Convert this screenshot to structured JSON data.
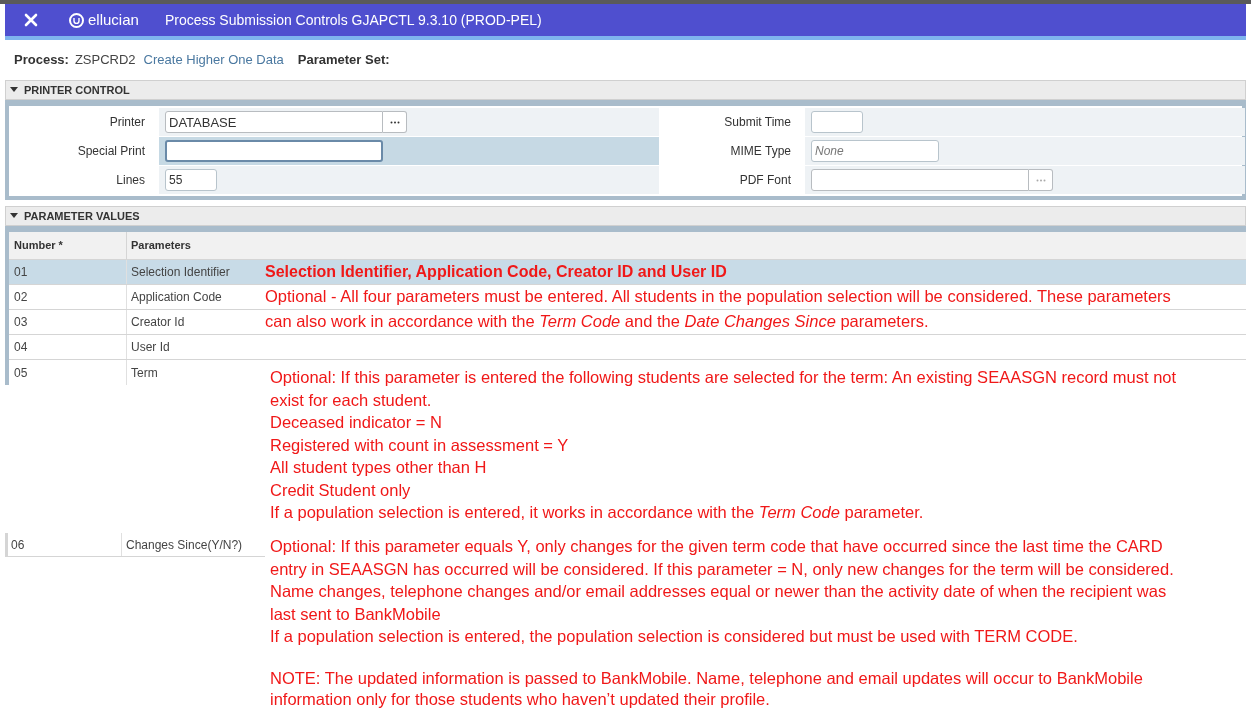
{
  "header": {
    "logo": "ellucian",
    "title": "Process Submission Controls GJAPCTL 9.3.10 (PROD-PEL)"
  },
  "process": {
    "label": "Process:",
    "code": "ZSPCRD2",
    "name": "Create Higher One Data",
    "parameter_set_label": "Parameter Set:"
  },
  "printer_control": {
    "title": "PRINTER CONTROL",
    "expanded": true,
    "left_fields": [
      {
        "label": "Printer",
        "value": "DATABASE",
        "kind": "lookup",
        "selected": false
      },
      {
        "label": "Special Print",
        "kind": "text",
        "selected": true
      },
      {
        "label": "Lines",
        "value": "55",
        "kind": "short",
        "selected": false
      }
    ],
    "right_fields": [
      {
        "label": "Submit Time",
        "kind": "short"
      },
      {
        "label": "MIME Type",
        "placeholder": "None",
        "kind": "text"
      },
      {
        "label": "PDF Font",
        "kind": "lookup_disabled"
      }
    ]
  },
  "parameter_values": {
    "title": "PARAMETER VALUES",
    "expanded": true,
    "columns": [
      "Number *",
      "Parameters"
    ],
    "rows": [
      {
        "number": "01",
        "parameter": "Selection Identifier",
        "selected": true
      },
      {
        "number": "02",
        "parameter": "Application Code",
        "selected": false
      },
      {
        "number": "03",
        "parameter": "Creator Id",
        "selected": false
      },
      {
        "number": "04",
        "parameter": "User Id",
        "selected": false
      },
      {
        "number": "05",
        "parameter": "Term",
        "selected": false
      }
    ],
    "row_06": {
      "number": "06",
      "parameter": "Changes Since(Y/N?)"
    }
  },
  "annotations": [
    {
      "kind": "heading",
      "lines": [
        "Selection Identifier, Application Code, Creator ID and User ID"
      ]
    },
    {
      "kind": "note",
      "lines": [
        "Optional - All four parameters must be entered.  All students in the population selection will be considered. These parameters",
        "can also work in accordance with the *Term Code* and the *Date Changes Since* parameters."
      ]
    },
    {
      "kind": "note",
      "lines": [
        "Optional:  If this parameter is entered the following students are selected for the term: An existing SEAASGN record must not",
        "exist for each student.",
        "Deceased indicator = N",
        "Registered with count in assessment = Y",
        "All student types other than  H",
        "Credit Student only",
        "If a population selection is entered, it works in accordance with the *Term Code* parameter."
      ]
    },
    {
      "kind": "note",
      "lines": [
        "Optional:  If this parameter equals Y, only changes for the given term code that have occurred since the last time the CARD",
        "entry in SEAASGN has occurred will be considered.  If this parameter = N, only new changes for the term will be considered.",
        "Name changes, telephone changes and/or email addresses equal or newer than the activity date of  when the recipient was",
        "last sent to BankMobile",
        "If a population selection is entered, the population selection is considered but must be used with TERM CODE."
      ]
    },
    {
      "kind": "note",
      "lines": [
        "NOTE:   The updated information is passed to BankMobile.   Name, telephone and email updates will occur to BankMobile",
        "information only for those students who haven’t updated their profile."
      ]
    }
  ]
}
